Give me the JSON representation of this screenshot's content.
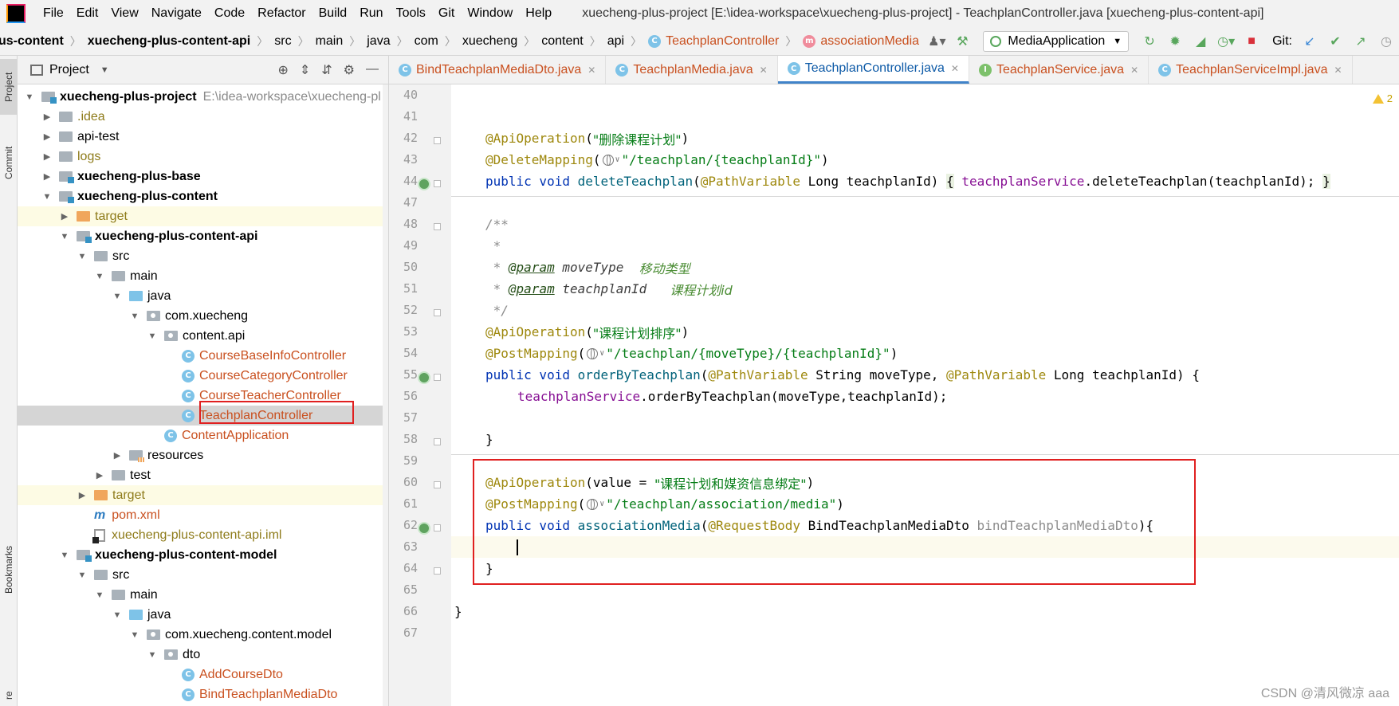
{
  "window": {
    "title": "xuecheng-plus-project [E:\\idea-workspace\\xuecheng-plus-project] - TeachplanController.java [xuecheng-plus-content-api]"
  },
  "menu": [
    "File",
    "Edit",
    "View",
    "Navigate",
    "Code",
    "Refactor",
    "Build",
    "Run",
    "Tools",
    "Git",
    "Window",
    "Help"
  ],
  "breadcrumbs": [
    "us-content",
    "xuecheng-plus-content-api",
    "src",
    "main",
    "java",
    "com",
    "xuecheng",
    "content",
    "api",
    "TeachplanController",
    "associationMedia"
  ],
  "toolbar": {
    "run_config": "MediaApplication",
    "git_label": "Git:"
  },
  "left_strip": {
    "project": "Project",
    "commit": "Commit",
    "bookmarks": "Bookmarks",
    "structure": "re"
  },
  "project_panel": {
    "title": "Project"
  },
  "tree": [
    {
      "label": "xuecheng-plus-project",
      "path": "E:\\idea-workspace\\xuecheng-pl"
    },
    {
      "label": ".idea"
    },
    {
      "label": "api-test"
    },
    {
      "label": "logs"
    },
    {
      "label": "xuecheng-plus-base"
    },
    {
      "label": "xuecheng-plus-content"
    },
    {
      "label": "target"
    },
    {
      "label": "xuecheng-plus-content-api"
    },
    {
      "label": "src"
    },
    {
      "label": "main"
    },
    {
      "label": "java"
    },
    {
      "label": "com.xuecheng"
    },
    {
      "label": "content.api"
    },
    {
      "label": "CourseBaseInfoController"
    },
    {
      "label": "CourseCategoryController"
    },
    {
      "label": "CourseTeacherController"
    },
    {
      "label": "TeachplanController"
    },
    {
      "label": "ContentApplication"
    },
    {
      "label": "resources"
    },
    {
      "label": "test"
    },
    {
      "label": "target"
    },
    {
      "label": "pom.xml"
    },
    {
      "label": "xuecheng-plus-content-api.iml"
    },
    {
      "label": "xuecheng-plus-content-model"
    },
    {
      "label": "src"
    },
    {
      "label": "main"
    },
    {
      "label": "java"
    },
    {
      "label": "com.xuecheng.content.model"
    },
    {
      "label": "dto"
    },
    {
      "label": "AddCourseDto"
    },
    {
      "label": "BindTeachplanMediaDto"
    }
  ],
  "tabs": [
    {
      "label": "BindTeachplanMediaDto.java",
      "icon": "C"
    },
    {
      "label": "TeachplanMedia.java",
      "icon": "C"
    },
    {
      "label": "TeachplanController.java",
      "icon": "C"
    },
    {
      "label": "TeachplanService.java",
      "icon": "I"
    },
    {
      "label": "TeachplanServiceImpl.java",
      "icon": "C"
    }
  ],
  "editor": {
    "warning_count": "2",
    "line_numbers": [
      "40",
      "41",
      "42",
      "43",
      "44",
      "47",
      "48",
      "49",
      "50",
      "51",
      "52",
      "53",
      "54",
      "55",
      "56",
      "57",
      "58",
      "59",
      "60",
      "61",
      "62",
      "63",
      "64",
      "65",
      "66",
      "67"
    ],
    "code": {
      "l42_annot": "@ApiOperation",
      "l42_str": "\"删除课程计划\"",
      "l43_annot": "@DeleteMapping",
      "l43_str": "\"/teachplan/{teachplanId}\"",
      "l44_kw": "public void",
      "l44_fn": "deleteTeachplan",
      "l44_annot": "@PathVariable",
      "l44_type": "Long",
      "l44_param": "teachplanId",
      "l44_field": "teachplanService",
      "l44_call": ".deleteTeachplan(teachplanId);",
      "l48": "/**",
      "l49": " *",
      "l50_tag": "@param",
      "l50_name": "moveType",
      "l50_desc": "移动类型",
      "l51_tag": "@param",
      "l51_name": "teachplanId",
      "l51_desc": "课程计划id",
      "l52": " */",
      "l53_annot": "@ApiOperation",
      "l53_str": "\"课程计划排序\"",
      "l54_annot": "@PostMapping",
      "l54_str": "\"/teachplan/{moveType}/{teachplanId}\"",
      "l55_kw": "public void",
      "l55_fn": "orderByTeachplan",
      "l55_annot1": "@PathVariable",
      "l55_type1": "String",
      "l55_param1": "moveType,",
      "l55_annot2": "@PathVariable",
      "l55_type2": "Long",
      "l55_param2": "teachplanId",
      "l56_field": "teachplanService",
      "l56_call": ".orderByTeachplan(moveType,teachplanId);",
      "l58": "}",
      "l60_annot": "@ApiOperation",
      "l60_attr": "value = ",
      "l60_str": "\"课程计划和媒资信息绑定\"",
      "l61_annot": "@PostMapping",
      "l61_str": "\"/teachplan/association/media\"",
      "l62_kw": "public void",
      "l62_fn": "associationMedia",
      "l62_annot": "@RequestBody",
      "l62_type": "BindTeachplanMediaDto",
      "l62_param": "bindTeachplanMediaDto",
      "l64": "}",
      "l66": "}"
    }
  },
  "watermark": "CSDN @清风微凉 aaa",
  "colors": {
    "highlight_box": "#e02020",
    "keyword": "#0033b3",
    "annotation": "#9e880d",
    "string": "#067d17",
    "method": "#00627a",
    "field": "#871094"
  }
}
